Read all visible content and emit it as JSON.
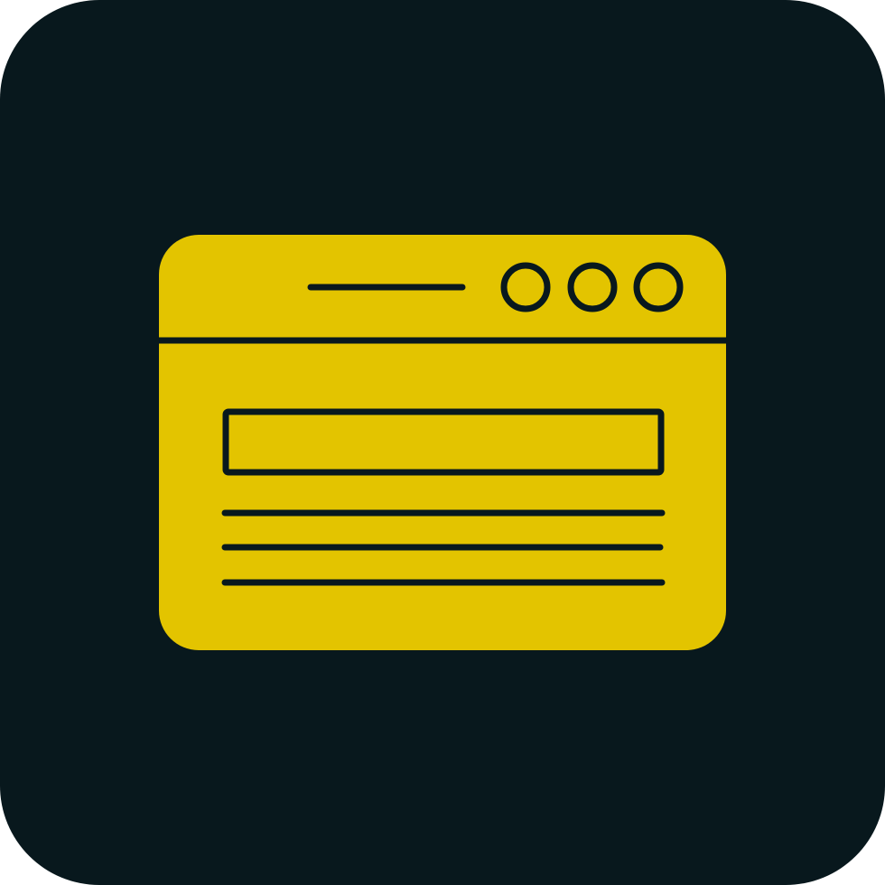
{
  "icon": {
    "name": "browser-window-icon",
    "colors": {
      "tile_background": "#08181d",
      "window_fill": "#e3c400",
      "line": "#08181d"
    },
    "window_controls": [
      "circle-icon",
      "circle-icon",
      "circle-icon"
    ]
  }
}
